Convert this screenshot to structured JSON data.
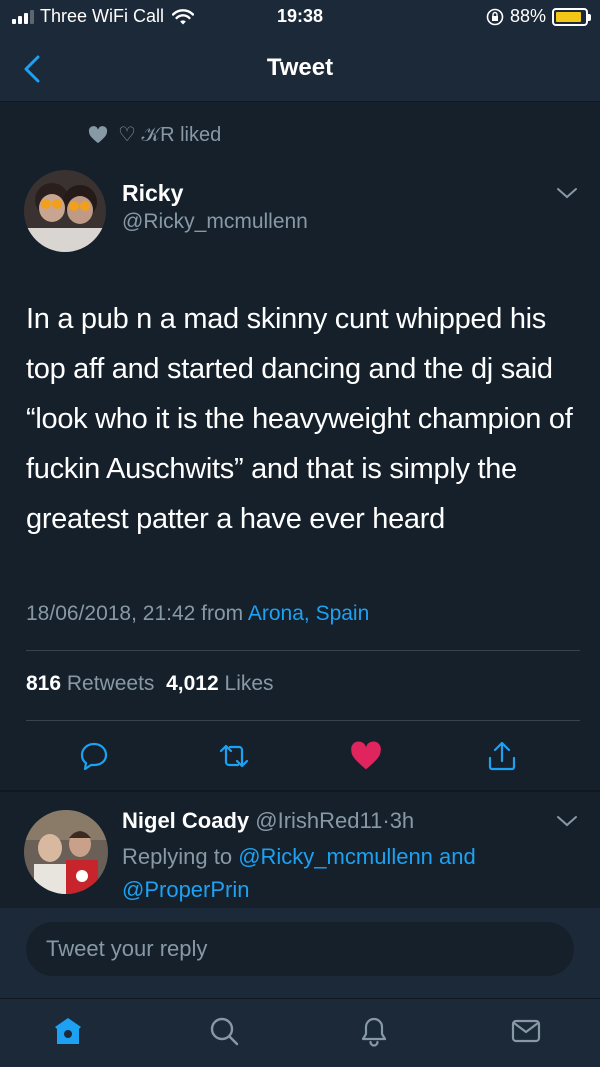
{
  "status_bar": {
    "carrier": "Three WiFi Call",
    "time": "19:38",
    "battery": "88%",
    "battery_level": 0.88
  },
  "nav": {
    "title": "Tweet",
    "back_icon": "chevron-left-icon"
  },
  "liked_by": {
    "text": "♡ 𝒦R liked",
    "icon": "heart-icon"
  },
  "tweet": {
    "author_name": "Ricky",
    "author_handle": "@Ricky_mcmullenn",
    "text": "In a pub n a mad skinny cunt whipped his top aff and started dancing and the dj said “look who it is the heavyweight champion of fuckin Auschwits” and that is simply the greatest patter a have ever heard",
    "timestamp": "18/06/2018, 21:42",
    "from_label": "from",
    "location": "Arona, Spain",
    "retweets_count": "816",
    "retweets_label": "Retweets",
    "likes_count": "4,012",
    "likes_label": "Likes",
    "liked": true
  },
  "reply": {
    "author_name": "Nigel Coady",
    "author_handle": "@IrishRed11",
    "separator": "·",
    "age": "3h",
    "replying_prefix": "Replying to",
    "reply_mentions": "@Ricky_mcmullenn and @ProperPrin"
  },
  "compose": {
    "placeholder": "Tweet your reply"
  },
  "tab_bar": {
    "items": [
      "home-icon",
      "search-icon",
      "notifications-icon",
      "messages-icon"
    ]
  },
  "colors": {
    "background": "#15202b",
    "bar_background": "#1c2938",
    "accent": "#1da1f2",
    "like": "#e0245e",
    "secondary_text": "#8899a6",
    "battery_fill": "#f5c518"
  }
}
